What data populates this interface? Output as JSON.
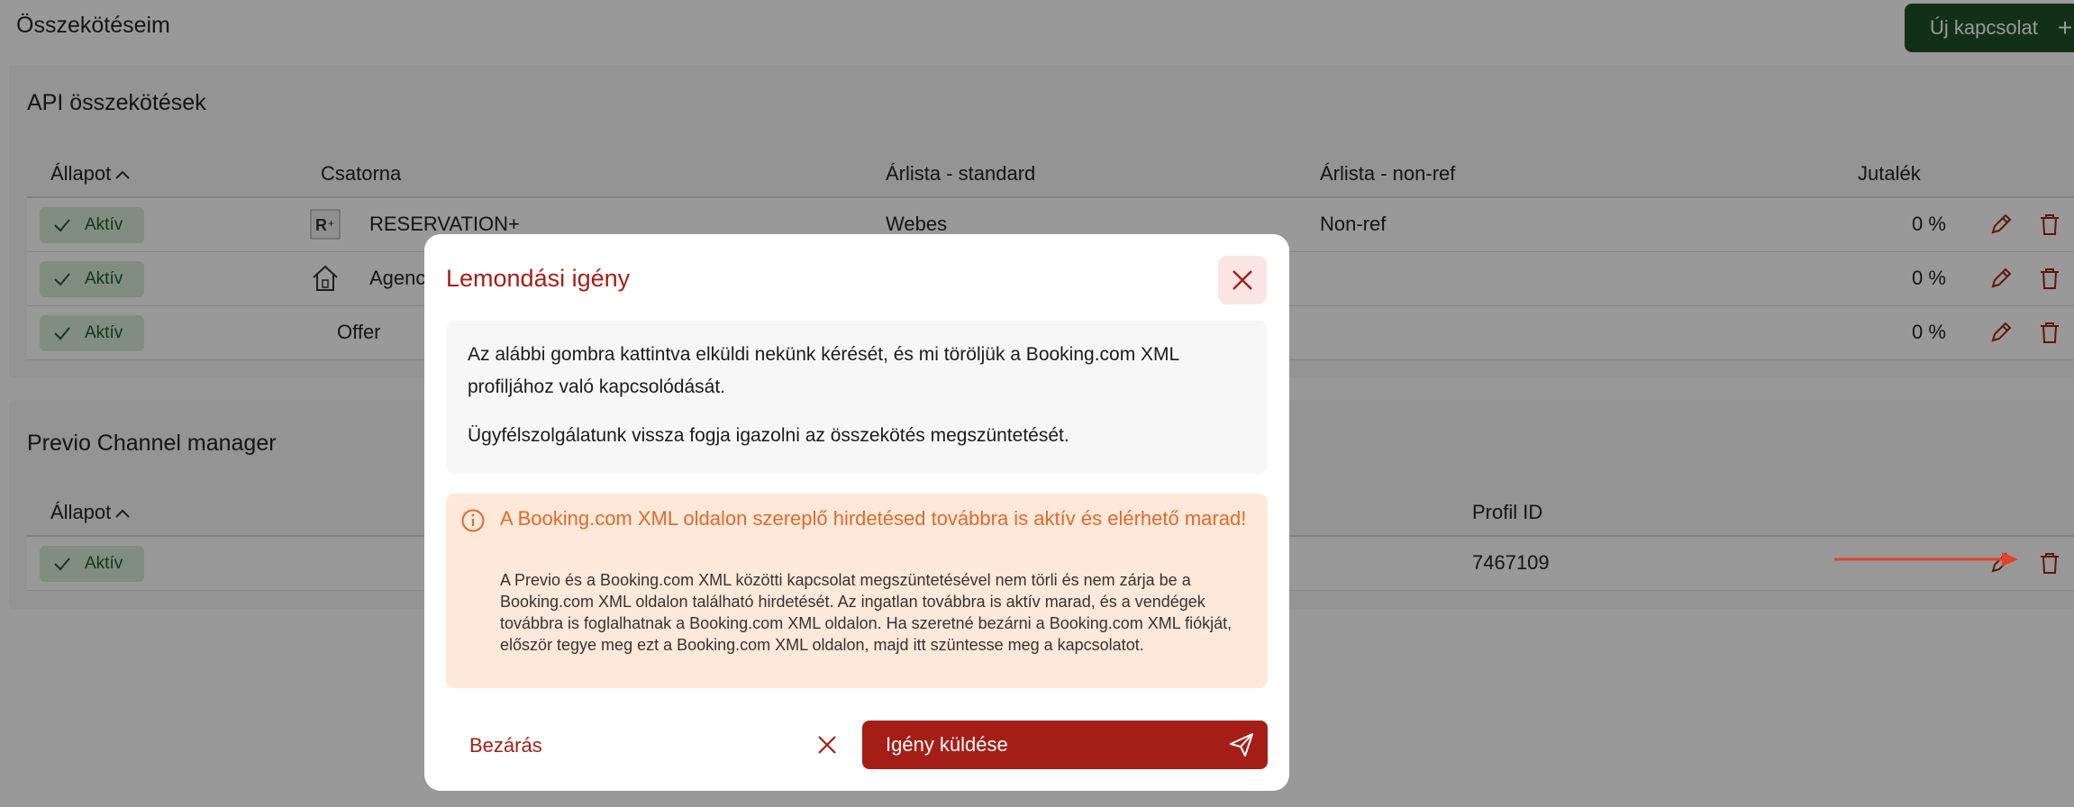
{
  "header": {
    "title": "Összekötéseim",
    "new_button": "Új kapcsolat",
    "new_button_icon": "plus-icon"
  },
  "api_section": {
    "title": "API összekötések",
    "columns": [
      "Állapot",
      "Csatorna",
      "Árlista - standard",
      "Árlista - non-ref",
      "Jutalék"
    ],
    "rows": [
      {
        "status": "Aktív",
        "channel": "RESERVATION+",
        "standard": "Webes",
        "nonref": "Non-ref",
        "commission": "0 %"
      },
      {
        "status": "Aktív",
        "channel": "Agency",
        "standard": "",
        "nonref": "",
        "commission": "0 %"
      },
      {
        "status": "Aktív",
        "channel": "Offer",
        "standard": "",
        "nonref": "",
        "commission": "0 %"
      }
    ]
  },
  "cm_section": {
    "title": "Previo Channel manager",
    "columns": [
      "Állapot",
      "Profil ID"
    ],
    "rows": [
      {
        "status": "Aktív",
        "profile_id": "7467109"
      }
    ]
  },
  "modal": {
    "title": "Lemondási igény",
    "info_line1": "Az alábbi gombra kattintva elküldi nekünk kérését, és mi töröljük a Booking.com XML profiljához való kapcsolódását.",
    "info_line2": "Ügyfélszolgálatunk vissza fogja igazolni az összekötés megszüntetését.",
    "warning_title": "A Booking.com XML oldalon szereplő hirdetésed továbbra is aktív és elérhető marad!",
    "warning_text": "A Previo és a Booking.com XML közötti kapcsolat megszüntetésével nem törli és nem zárja be a Booking.com XML oldalon található hirdetését. Az ingatlan továbbra is aktív marad, és a vendégek továbbra is foglalhatnak a Booking.com XML oldalon. Ha szeretné bezárni a Booking.com XML fiókját, először tegye meg ezt a Booking.com XML oldalon, majd itt szüntesse meg a kapcsolatot.",
    "cancel_label": "Bezárás",
    "send_label": "Igény küldése"
  },
  "colors": {
    "accent_red": "#a51e16",
    "success_green": "#1e5128",
    "warning_orange": "#e26a2c"
  }
}
